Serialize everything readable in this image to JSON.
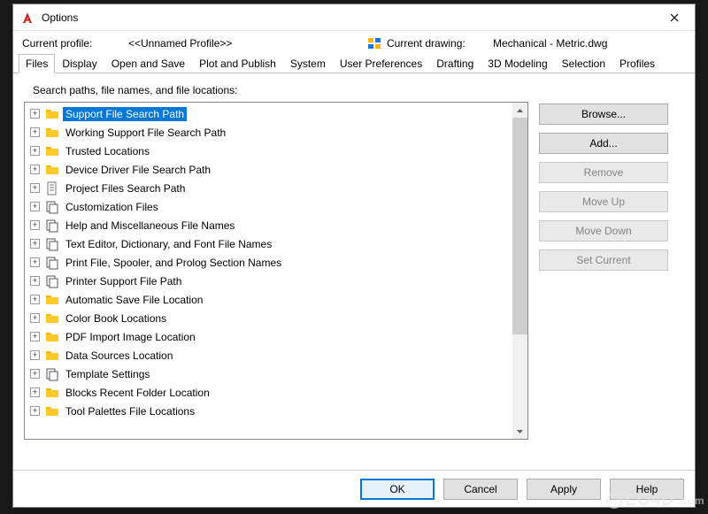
{
  "window": {
    "title": "Options"
  },
  "header": {
    "profile_label": "Current profile:",
    "profile_value": "<<Unnamed Profile>>",
    "drawing_label": "Current drawing:",
    "drawing_value": "Mechanical - Metric.dwg"
  },
  "tabs": [
    {
      "label": "Files",
      "active": true
    },
    {
      "label": "Display"
    },
    {
      "label": "Open and Save"
    },
    {
      "label": "Plot and Publish"
    },
    {
      "label": "System"
    },
    {
      "label": "User Preferences"
    },
    {
      "label": "Drafting"
    },
    {
      "label": "3D Modeling"
    },
    {
      "label": "Selection"
    },
    {
      "label": "Profiles"
    }
  ],
  "content_label": "Search paths, file names, and file locations:",
  "tree": [
    {
      "label": "Support File Search Path",
      "icon": "folder",
      "selected": true
    },
    {
      "label": "Working Support File Search Path",
      "icon": "folder"
    },
    {
      "label": "Trusted Locations",
      "icon": "folder"
    },
    {
      "label": "Device Driver File Search Path",
      "icon": "folder"
    },
    {
      "label": "Project Files Search Path",
      "icon": "doc"
    },
    {
      "label": "Customization Files",
      "icon": "stack"
    },
    {
      "label": "Help and Miscellaneous File Names",
      "icon": "stack"
    },
    {
      "label": "Text Editor, Dictionary, and Font File Names",
      "icon": "stack"
    },
    {
      "label": "Print File, Spooler, and Prolog Section Names",
      "icon": "stack"
    },
    {
      "label": "Printer Support File Path",
      "icon": "stack"
    },
    {
      "label": "Automatic Save File Location",
      "icon": "folder"
    },
    {
      "label": "Color Book Locations",
      "icon": "folder"
    },
    {
      "label": "PDF Import Image Location",
      "icon": "folder"
    },
    {
      "label": "Data Sources Location",
      "icon": "folder"
    },
    {
      "label": "Template Settings",
      "icon": "stack"
    },
    {
      "label": "Blocks Recent Folder Location",
      "icon": "folder"
    },
    {
      "label": "Tool Palettes File Locations",
      "icon": "folder"
    }
  ],
  "side_buttons": {
    "browse": "Browse...",
    "add": "Add...",
    "remove": "Remove",
    "moveup": "Move Up",
    "movedown": "Move Down",
    "setcurrent": "Set Current"
  },
  "footer": {
    "ok": "OK",
    "cancel": "Cancel",
    "apply": "Apply",
    "help": "Help"
  },
  "watermark": "LO4D"
}
